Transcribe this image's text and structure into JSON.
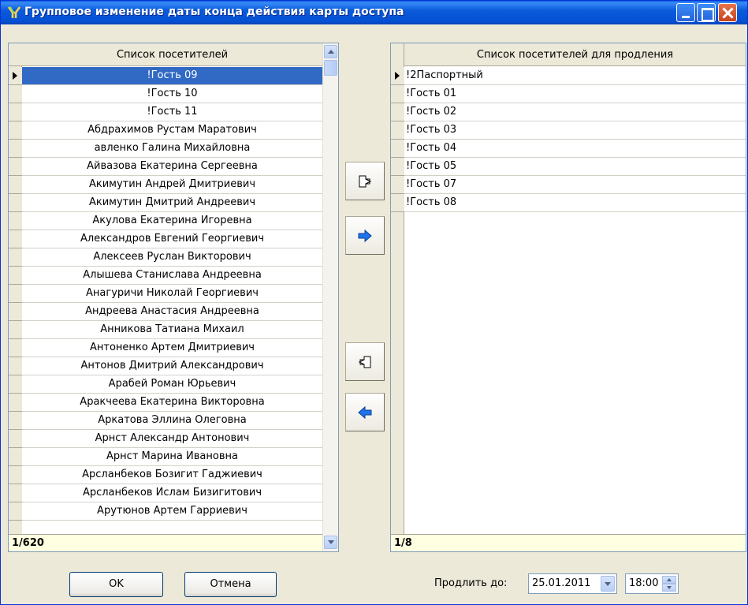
{
  "window": {
    "title": "Групповое изменение даты конца действия карты доступа"
  },
  "left_list": {
    "header": "Список посетителей",
    "rows": [
      "!Гость 09",
      "!Гость 10",
      "!Гость 11",
      "Абдрахимов Рустам Маратович",
      "авленко Галина Михайловна",
      "Айвазова Екатерина Сергеевна",
      "Акимутин Андрей Дмитриевич",
      "Акимутин Дмитрий Андреевич",
      "Акулова Екатерина Игоревна",
      "Александров Евгений Георгиевич",
      "Алексеев Руслан Викторович",
      "Алышева Станислава Андреевна",
      "Анагуричи Николай Георгиевич",
      "Андреева Анастасия Андреевна",
      "Анникова Татиана Михаил",
      "Антоненко Артем Дмитриевич",
      "Антонов Дмитрий Александрович",
      "Арабей Роман Юрьевич",
      "Аракчеева Екатерина Викторовна",
      "Аркатова Эллина Олеговна",
      "Арнст Александр Антонович",
      "Арнст Марина Ивановна",
      "Арсланбеков Бозигит Гаджиевич",
      "Арсланбеков Ислам Бизигитович",
      "Арутюнов Артем Гарриевич"
    ],
    "footer": "1/620"
  },
  "right_list": {
    "header": "Список посетителей для продления",
    "rows": [
      "!2Паспортный",
      "!Гость 01",
      "!Гость 02",
      "!Гость 03",
      "!Гость 04",
      "!Гость 05",
      "!Гость 07",
      "!Гость 08"
    ],
    "footer": "1/8"
  },
  "buttons": {
    "ok": "OK",
    "cancel": "Отмена"
  },
  "extend": {
    "label": "Продлить до:",
    "date": "25.01.2011",
    "time": "18:00"
  },
  "colors": {
    "selection": "#316AC5",
    "titlebar": "#0550D4",
    "footer_bg": "#FFFFE1"
  }
}
